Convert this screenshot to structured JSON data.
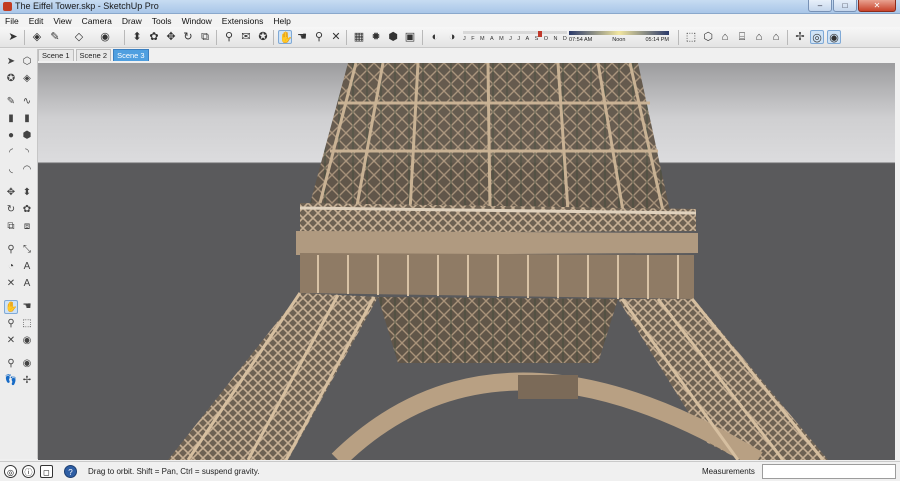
{
  "window": {
    "title": "The Eiffel Tower.skp - SketchUp Pro",
    "buttons": {
      "minimize": "–",
      "maximize": "□",
      "close": "✕"
    }
  },
  "menu": [
    "File",
    "Edit",
    "View",
    "Camera",
    "Draw",
    "Tools",
    "Window",
    "Extensions",
    "Help"
  ],
  "toolbar": {
    "shadow_months": [
      "J",
      "F",
      "M",
      "A",
      "M",
      "J",
      "J",
      "A",
      "S",
      "O",
      "N",
      "D"
    ],
    "shadow_month_position": 0.72,
    "time_labels": [
      "07:54 AM",
      "Noon",
      "05:14 PM"
    ],
    "icons": {
      "select": "arrow-icon",
      "eraser": "eraser-icon",
      "pencil": "pencil-icon",
      "orbit": "orbit-icon",
      "pan": "pan-icon",
      "zoom": "zoom-icon",
      "zoom_extents": "zoom-extents-icon"
    }
  },
  "scenes": {
    "tabs": [
      "Scene 1",
      "Scene 2",
      "Scene 3"
    ],
    "active": 2
  },
  "status": {
    "hint": "Drag to orbit. Shift = Pan, Ctrl = suspend gravity.",
    "measurements_label": "Measurements",
    "measurements_value": ""
  },
  "colors": {
    "sky": "#d3d3d5",
    "ground": "#5a5a5c",
    "tower": "#a99278",
    "active_tab": "#4f9fe0"
  }
}
